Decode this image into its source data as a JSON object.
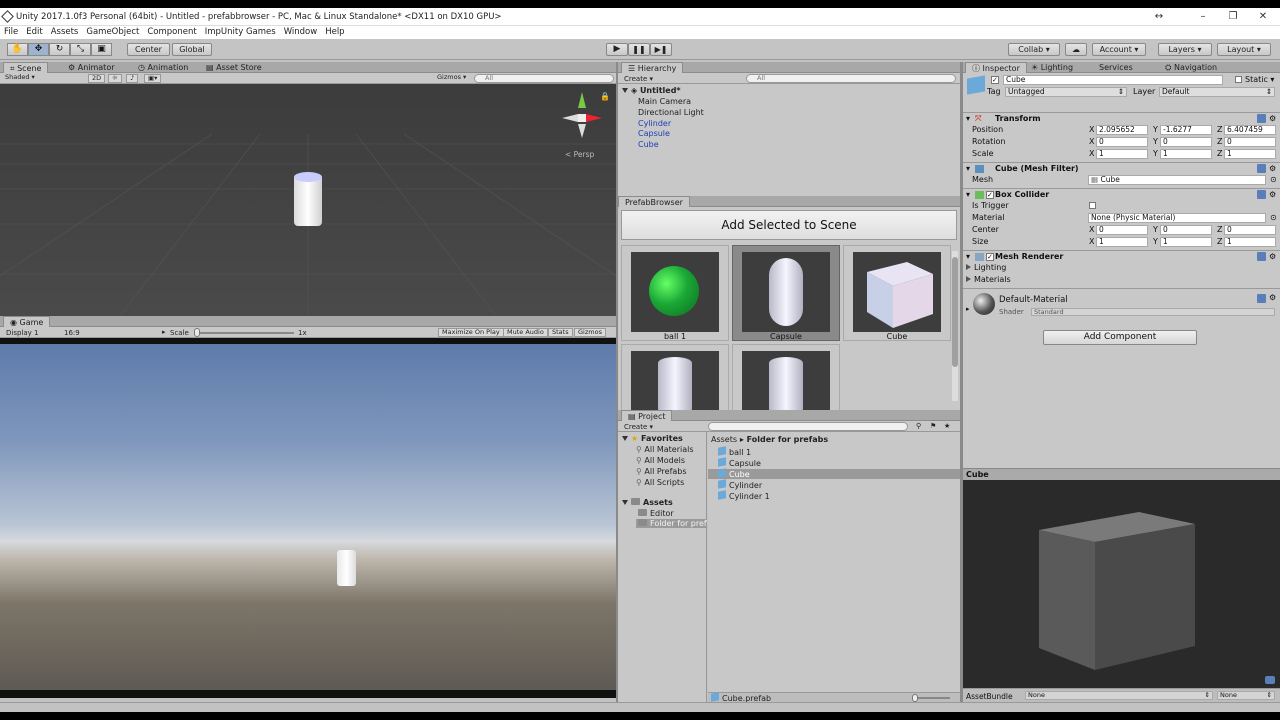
{
  "window": {
    "title": "Unity 2017.1.0f3 Personal (64bit) - Untitled - prefabbrowser - PC, Mac & Linux Standalone* <DX11 on DX10 GPU>"
  },
  "menu": [
    "File",
    "Edit",
    "Assets",
    "GameObject",
    "Component",
    "ImpUnity Games",
    "Window",
    "Help"
  ],
  "toolbar": {
    "pivot": "Center",
    "space": "Global",
    "collab": "Collab",
    "account": "Account",
    "layers": "Layers",
    "layout": "Layout"
  },
  "scene": {
    "tabs": [
      "Scene",
      "Animator",
      "Animation",
      "Asset Store"
    ],
    "shading": "Shaded",
    "mode2d": "2D",
    "gizmos": "Gizmos",
    "search": "All",
    "persp": "< Persp"
  },
  "game": {
    "tab": "Game",
    "display": "Display 1",
    "aspect": "16:9",
    "scale_label": "Scale",
    "scale_value": "1x",
    "buttons": [
      "Maximize On Play",
      "Mute Audio",
      "Stats",
      "Gizmos"
    ]
  },
  "hierarchy": {
    "tab": "Hierarchy",
    "create": "Create",
    "search": "All",
    "scene": "Untitled*",
    "items": [
      {
        "name": "Main Camera",
        "prefab": false
      },
      {
        "name": "Directional Light",
        "prefab": false
      },
      {
        "name": "Cylinder",
        "prefab": true
      },
      {
        "name": "Capsule",
        "prefab": true
      },
      {
        "name": "Cube",
        "prefab": true
      }
    ]
  },
  "prefab_browser": {
    "tab": "PrefabBrowser",
    "add_button": "Add Selected to Scene",
    "items": [
      "ball 1",
      "Capsule",
      "Cube",
      "",
      ""
    ]
  },
  "project": {
    "tab": "Project",
    "create": "Create",
    "favorites_label": "Favorites",
    "favorites": [
      "All Materials",
      "All Models",
      "All Prefabs",
      "All Scripts"
    ],
    "assets_label": "Assets",
    "asset_folders": [
      "Editor",
      "Folder for prefabs"
    ],
    "breadcrumb": [
      "Assets",
      "Folder for prefabs"
    ],
    "files": [
      "ball 1",
      "Capsule",
      "Cube",
      "Cylinder",
      "Cylinder 1"
    ],
    "selected_file": "Cube",
    "status": "Cube.prefab"
  },
  "inspector": {
    "tabs": [
      "Inspector",
      "Lighting",
      "Services",
      "Navigation"
    ],
    "object_name": "Cube",
    "static_label": "Static",
    "tag_label": "Tag",
    "tag": "Untagged",
    "layer_label": "Layer",
    "layer": "Default",
    "transform": {
      "title": "Transform",
      "position_label": "Position",
      "rotation_label": "Rotation",
      "scale_label": "Scale",
      "position": [
        "2.095652",
        "-1.6277",
        "6.407459"
      ],
      "rotation": [
        "0",
        "0",
        "0"
      ],
      "scale": [
        "1",
        "1",
        "1"
      ]
    },
    "mesh_filter": {
      "title": "Cube (Mesh Filter)",
      "mesh_label": "Mesh",
      "mesh": "Cube"
    },
    "box_collider": {
      "title": "Box Collider",
      "trigger_label": "Is Trigger",
      "material_label": "Material",
      "material": "None (Physic Material)",
      "center_label": "Center",
      "center": [
        "0",
        "0",
        "0"
      ],
      "size_label": "Size",
      "size": [
        "1",
        "1",
        "1"
      ]
    },
    "mesh_renderer": {
      "title": "Mesh Renderer",
      "lighting": "Lighting",
      "materials": "Materials"
    },
    "material": {
      "name": "Default-Material",
      "shader_label": "Shader",
      "shader": "Standard"
    },
    "add_component": "Add Component",
    "preview_title": "Cube",
    "assetbundle_label": "AssetBundle",
    "assetbundle": "None",
    "variant": "None"
  }
}
